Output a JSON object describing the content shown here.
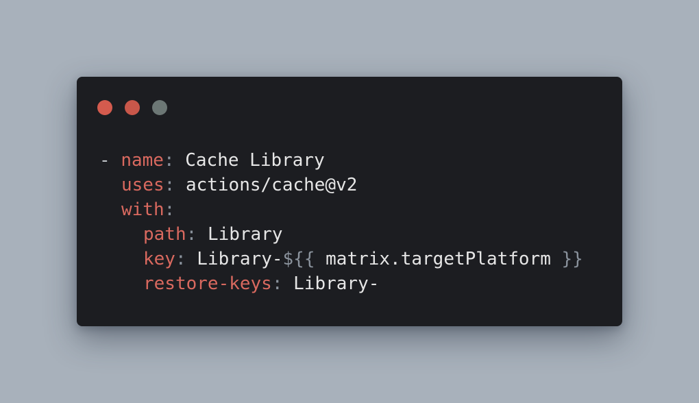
{
  "colors": {
    "background": "#a8b1bb",
    "window": "#1c1d21",
    "dot_red": "#d45b4e",
    "dot_red2": "#c8574a",
    "dot_gray": "#6c7775",
    "key": "#d9695f",
    "punctuation": "#8a929c",
    "value": "#e6e6e6",
    "dash": "#c0c4c8"
  },
  "window_dots": [
    {
      "name": "close",
      "color": "#d45b4e"
    },
    {
      "name": "minimize",
      "color": "#c8574a"
    },
    {
      "name": "zoom",
      "color": "#6c7775"
    }
  ],
  "code": {
    "line1": {
      "dash": "-",
      "key": "name",
      "colon": ":",
      "value": "Cache Library"
    },
    "line2": {
      "key": "uses",
      "colon": ":",
      "value": "actions/cache@v2"
    },
    "line3": {
      "key": "with",
      "colon": ":"
    },
    "line4": {
      "key": "path",
      "colon": ":",
      "value": "Library"
    },
    "line5": {
      "key": "key",
      "colon": ":",
      "value_prefix": "Library-",
      "expr_open": "${{",
      "expr": "matrix.targetPlatform",
      "expr_close": "}}"
    },
    "line6": {
      "key": "restore-keys",
      "colon": ":",
      "value": "Library-"
    }
  }
}
